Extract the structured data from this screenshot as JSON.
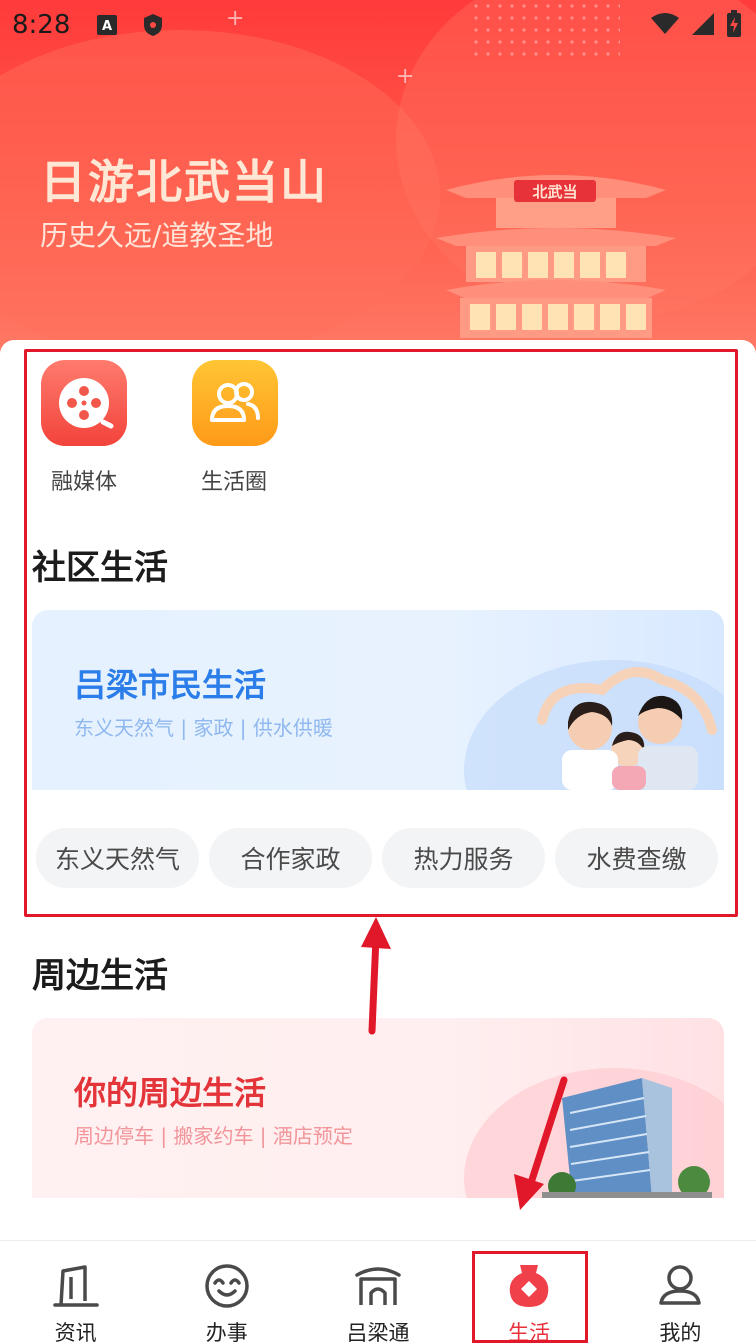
{
  "status_bar": {
    "time": "8:28"
  },
  "hero": {
    "title": "日游北武当山",
    "subtitle": "历史久远/道教圣地",
    "sign": "北武当"
  },
  "apps": [
    {
      "label": "融媒体",
      "icon": "film-reel-icon"
    },
    {
      "label": "生活圈",
      "icon": "people-group-icon"
    }
  ],
  "community": {
    "section_title": "社区生活",
    "banner_title": "吕梁市民生活",
    "banner_subtitle": "东义天然气 | 家政 | 供水供暖",
    "chips": [
      "东义天然气",
      "合作家政",
      "热力服务",
      "水费查缴"
    ]
  },
  "nearby": {
    "section_title": "周边生活",
    "banner_title": "你的周边生活",
    "banner_subtitle": "周边停车 | 搬家约车 | 酒店预定"
  },
  "nav": {
    "items": [
      {
        "label": "资讯",
        "icon": "news-icon"
      },
      {
        "label": "办事",
        "icon": "service-icon"
      },
      {
        "label": "吕梁通",
        "icon": "landmark-icon"
      },
      {
        "label": "生活",
        "icon": "vase-icon",
        "active": true
      },
      {
        "label": "我的",
        "icon": "user-icon"
      }
    ]
  },
  "colors": {
    "accent": "#e8313b",
    "highlight": "#e0182a",
    "blue": "#2b7de9"
  }
}
